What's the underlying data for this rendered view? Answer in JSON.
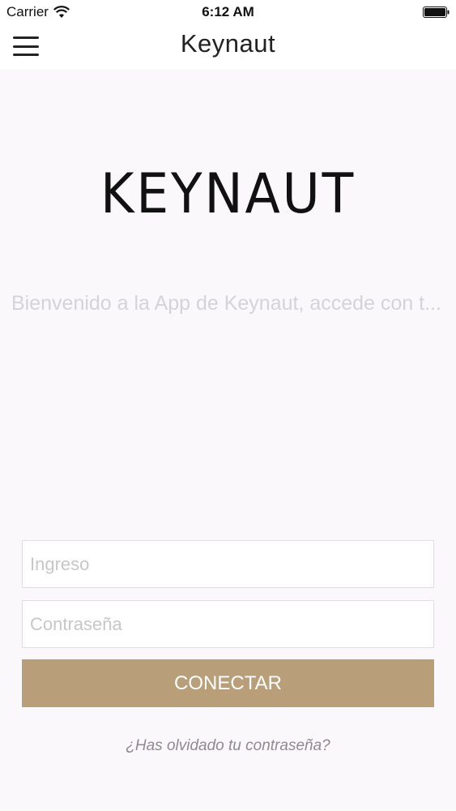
{
  "status_bar": {
    "carrier": "Carrier",
    "time": "6:12 AM",
    "wifi_icon": "wifi-icon",
    "battery_icon": "battery-icon"
  },
  "nav": {
    "menu_icon": "hamburger-menu-icon",
    "title": "Keynaut"
  },
  "logo_text": "KEYNAUT",
  "welcome_text": "Bienvenido a la App de Keynaut, accede con t...",
  "form": {
    "login_placeholder": "Ingreso",
    "login_value": "",
    "password_placeholder": "Contraseña",
    "password_value": "",
    "connect_label": "CONECTAR",
    "forgot_label": "¿Has olvidado tu contraseña?"
  },
  "colors": {
    "accent": "#b99f79",
    "background": "#faf8fb",
    "placeholder": "#c9c6ca"
  }
}
